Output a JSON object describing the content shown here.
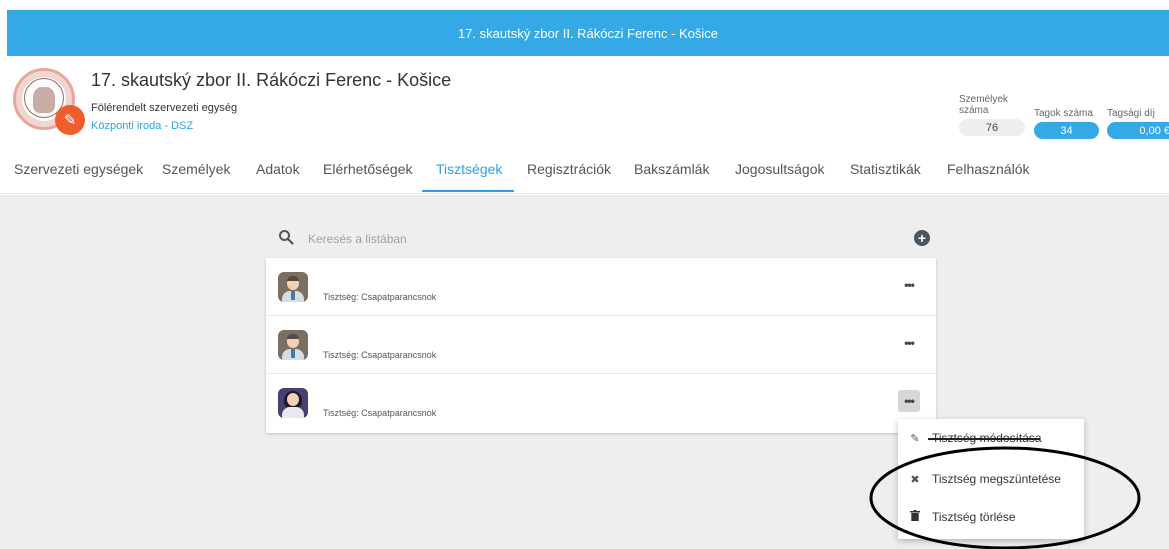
{
  "topbar": {
    "title": "17. skautský zbor II. Rákóczi Ferenc - Košice"
  },
  "header": {
    "title": "17. skautský zbor II. Rákóczi Ferenc - Košice",
    "subtitle": "Fölérendelt szervezeti egység",
    "parent_link": "Központi iroda - DSZ",
    "edit_icon": "pencil-icon"
  },
  "stats": {
    "persons": {
      "label_line1": "Személyek",
      "label_line2": "száma",
      "value": "76"
    },
    "members": {
      "label": "Tagok száma",
      "value": "34"
    },
    "fee": {
      "label": "Tagsági díj",
      "value": "0,00 €"
    }
  },
  "tabs": [
    {
      "label": "Szervezeti egységek"
    },
    {
      "label": "Személyek"
    },
    {
      "label": "Adatok"
    },
    {
      "label": "Elérhetőségek"
    },
    {
      "label": "Tisztségek",
      "active": true
    },
    {
      "label": "Regisztrációk"
    },
    {
      "label": "Bakszámlák"
    },
    {
      "label": "Jogosultságok"
    },
    {
      "label": "Statisztikák"
    },
    {
      "label": "Felhasználók"
    }
  ],
  "search": {
    "placeholder": "Keresés a listában",
    "icon": "search-icon",
    "add_icon": "plus-circle-icon"
  },
  "rows": [
    {
      "text": "Tisztség: Csapatparancsnok",
      "avatar": "male"
    },
    {
      "text": "Tisztség: Csapatparancsnok",
      "avatar": "male"
    },
    {
      "text": "Tisztség: Csapatparancsnok",
      "avatar": "female"
    }
  ],
  "more_label": "•••",
  "menu": {
    "items": [
      {
        "label": "Tisztség módosítása",
        "icon": "edit-icon"
      },
      {
        "label": "Tisztség megszüntetése",
        "icon": "close-icon"
      },
      {
        "label": "Tisztség törlése",
        "icon": "trash-icon"
      }
    ]
  },
  "colors": {
    "accent": "#35a9e6",
    "link": "#2aa3e3",
    "badge": "#ee5d2a",
    "background": "#eeeeee"
  }
}
